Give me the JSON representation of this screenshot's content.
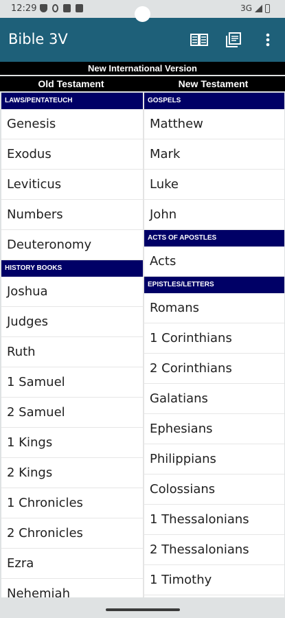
{
  "status": {
    "time": "12:29",
    "network": "3G"
  },
  "app": {
    "title": "Bible 3V",
    "icons": [
      "book-open-icon",
      "library-icon",
      "more-vert-icon"
    ]
  },
  "version": "New International Version",
  "testaments": {
    "old": "Old Testament",
    "new": "New Testament"
  },
  "old_testament": {
    "sections": [
      {
        "header": "Laws/Pentateuch",
        "books": [
          "Genesis",
          "Exodus",
          "Leviticus",
          "Numbers",
          "Deuteronomy"
        ]
      },
      {
        "header": "History Books",
        "books": [
          "Joshua",
          "Judges",
          "Ruth",
          "1 Samuel",
          "2 Samuel",
          "1 Kings",
          "2 Kings",
          "1 Chronicles",
          "2 Chronicles",
          "Ezra",
          "Nehemiah"
        ]
      }
    ]
  },
  "new_testament": {
    "sections": [
      {
        "header": "Gospels",
        "books": [
          "Matthew",
          "Mark",
          "Luke",
          "John"
        ]
      },
      {
        "header": "Acts of Apostles",
        "books": [
          "Acts"
        ]
      },
      {
        "header": "Epistles/Letters",
        "books": [
          "Romans",
          "1 Corinthians",
          "2 Corinthians",
          "Galatians",
          "Ephesians",
          "Philippians",
          "Colossians",
          "1 Thessalonians",
          "2 Thessalonians",
          "1 Timothy"
        ]
      }
    ]
  },
  "colors": {
    "app_bar": "#1e6079",
    "section_header": "#000066",
    "version_bar": "#000000"
  }
}
